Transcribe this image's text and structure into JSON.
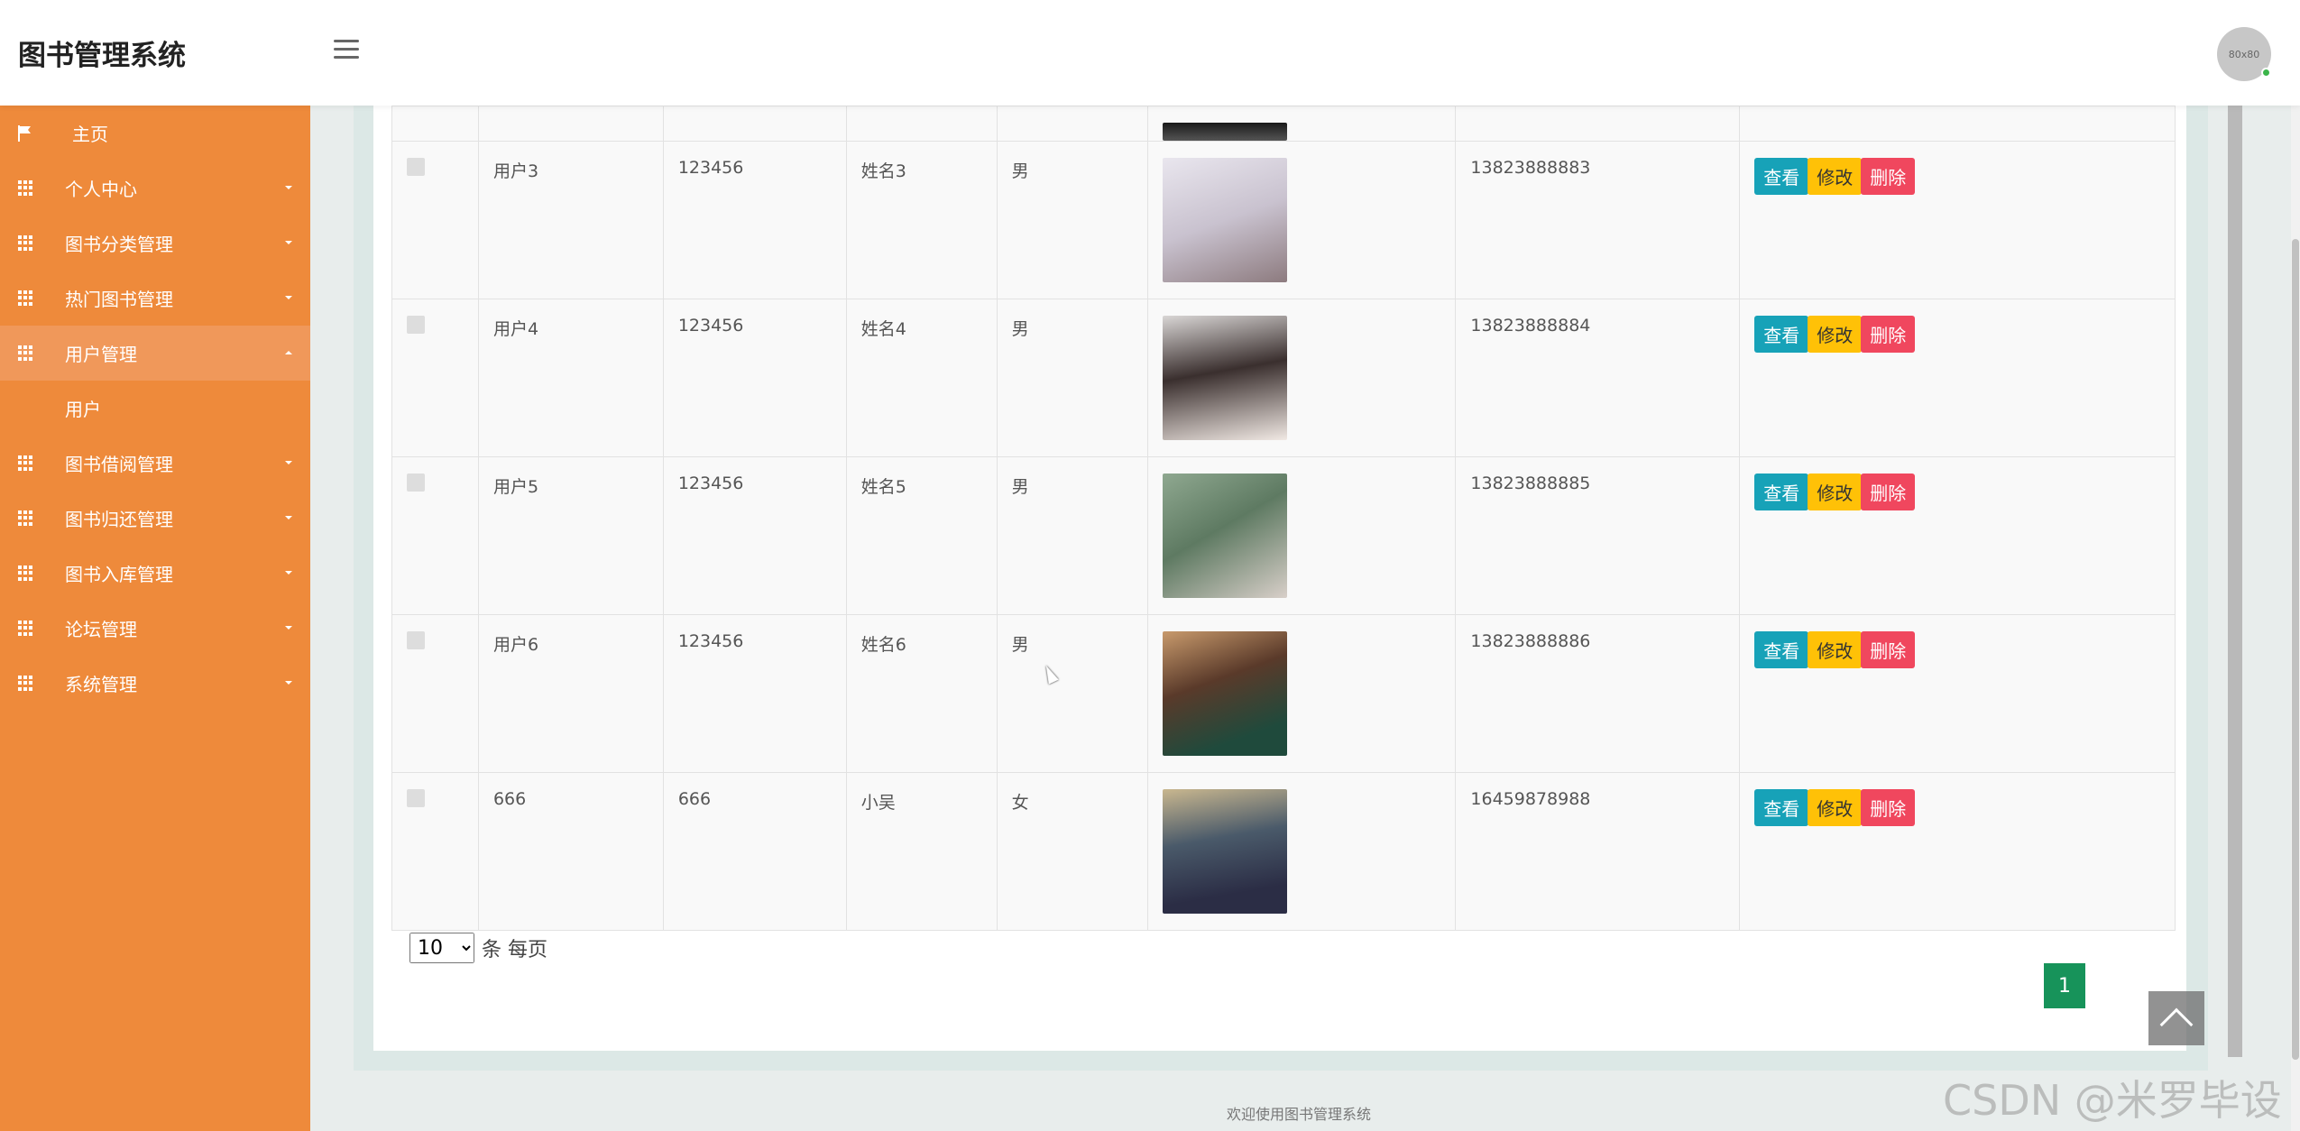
{
  "header": {
    "title": "图书管理系统",
    "avatar_text": "80x80"
  },
  "sidebar": {
    "items": [
      {
        "label": "主页"
      },
      {
        "label": "个人中心"
      },
      {
        "label": "图书分类管理"
      },
      {
        "label": "热门图书管理"
      },
      {
        "label": "用户管理",
        "sub": "用户"
      },
      {
        "label": "图书借阅管理"
      },
      {
        "label": "图书归还管理"
      },
      {
        "label": "图书入库管理"
      },
      {
        "label": "论坛管理"
      },
      {
        "label": "系统管理"
      }
    ]
  },
  "table": {
    "rows": [
      {
        "account": "用户3",
        "password": "123456",
        "name": "姓名3",
        "gender": "男",
        "phone": "13823888883"
      },
      {
        "account": "用户4",
        "password": "123456",
        "name": "姓名4",
        "gender": "男",
        "phone": "13823888884"
      },
      {
        "account": "用户5",
        "password": "123456",
        "name": "姓名5",
        "gender": "男",
        "phone": "13823888885"
      },
      {
        "account": "用户6",
        "password": "123456",
        "name": "姓名6",
        "gender": "男",
        "phone": "13823888886"
      },
      {
        "account": "666",
        "password": "666",
        "name": "小吴",
        "gender": "女",
        "phone": "16459878988"
      }
    ],
    "actions": {
      "view": "查看",
      "edit": "修改",
      "delete": "删除"
    }
  },
  "pager": {
    "page_size": "10",
    "suffix": "条 每页",
    "current_page": "1"
  },
  "footer": {
    "text": "欢迎使用图书管理系统"
  },
  "watermark": "CSDN @米罗毕设",
  "colors": {
    "sidebar": "#ee8a3b",
    "view": "#17a2b8",
    "edit": "#ffc107",
    "delete": "#f0475e",
    "page": "#17935a"
  }
}
